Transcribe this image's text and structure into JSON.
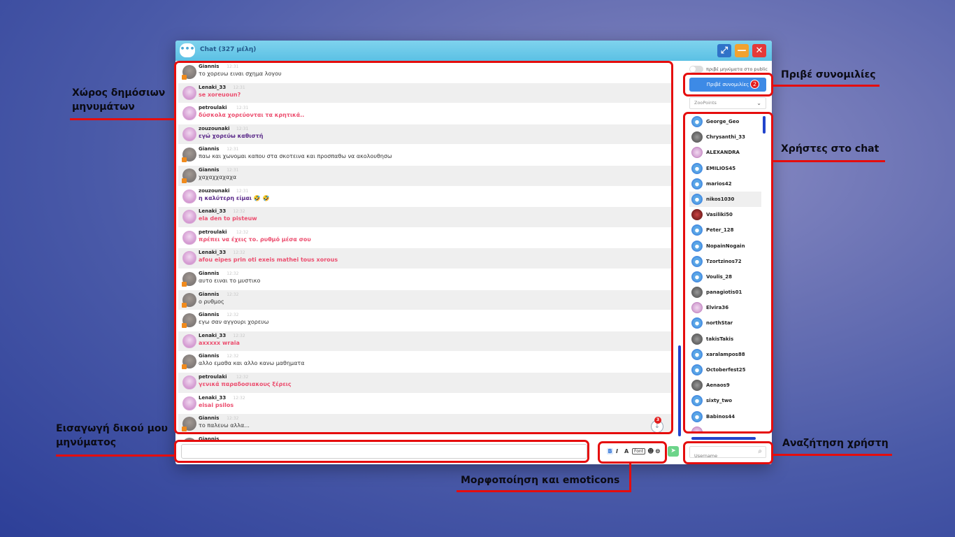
{
  "window": {
    "title": "Chat (327 μέλη)"
  },
  "messages": [
    {
      "nick": "Giannis",
      "time": "12:31",
      "text": "το χορευω ειναι σχημα λογου",
      "style": "normal",
      "gender": "m"
    },
    {
      "nick": "Lenaki_33",
      "time": "12:31",
      "text": "se xoreuoun?",
      "style": "pink",
      "gender": "f"
    },
    {
      "nick": "petroulaki",
      "time": "12:31",
      "text": "δύσκολα χορεύονται τα κρητικά..",
      "style": "pink",
      "gender": "f"
    },
    {
      "nick": "zouzounaki",
      "time": "12:31",
      "text": "εγώ χορεύω καθιστή",
      "style": "purple",
      "gender": "f"
    },
    {
      "nick": "Giannis",
      "time": "12:31",
      "text": "παω και χωνομαι καπου στα σκοτεινα και προσπαθω να ακολουθησω",
      "style": "normal",
      "gender": "m"
    },
    {
      "nick": "Giannis",
      "time": "12:31",
      "text": "χαχαχχαχαχα",
      "style": "normal",
      "gender": "m"
    },
    {
      "nick": "zouzounaki",
      "time": "12:31",
      "text": "η καλύτερη είμαι 🤣 🤣",
      "style": "purple",
      "gender": "f"
    },
    {
      "nick": "Lenaki_33",
      "time": "12:32",
      "text": "ela den to pisteuw",
      "style": "pink",
      "gender": "f"
    },
    {
      "nick": "petroulaki",
      "time": "12:32",
      "text": "πρέπει να έχεις το. ρυθμό μέσα σου",
      "style": "pink",
      "gender": "f"
    },
    {
      "nick": "Lenaki_33",
      "time": "12:32",
      "text": "afou eipes prin oti exeis mathei tous xorous",
      "style": "pink",
      "gender": "f"
    },
    {
      "nick": "Giannis",
      "time": "12:32",
      "text": "αυτο ειναι το μυστικο",
      "style": "normal",
      "gender": "m"
    },
    {
      "nick": "Giannis",
      "time": "12:32",
      "text": "ο ρυθμος",
      "style": "normal",
      "gender": "m"
    },
    {
      "nick": "Giannis",
      "time": "12:32",
      "text": "εγω σαν αγγουρι χορευω",
      "style": "normal",
      "gender": "m"
    },
    {
      "nick": "Lenaki_33",
      "time": "12:32",
      "text": "axxxxx wraia",
      "style": "pink",
      "gender": "f"
    },
    {
      "nick": "Giannis",
      "time": "12:32",
      "text": "αλλο εμαθα και αλλο κανω μαθηματα",
      "style": "normal",
      "gender": "m"
    },
    {
      "nick": "petroulaki",
      "time": "12:32",
      "text": "γενικά παραδοσιακους ξέρεις",
      "style": "pink",
      "gender": "f"
    },
    {
      "nick": "Lenaki_33",
      "time": "12:32",
      "text": "eisai psilos",
      "style": "pink",
      "gender": "f"
    },
    {
      "nick": "Giannis",
      "time": "12:32",
      "text": "το παλευω αλλα...",
      "style": "normal",
      "gender": "m"
    },
    {
      "nick": "Giannis",
      "time": "",
      "text": "",
      "style": "normal",
      "gender": "m"
    }
  ],
  "new_messages_count": "3",
  "composer": {
    "placeholder": ""
  },
  "formatting": {
    "bold": "B",
    "italic": "I",
    "color": "A",
    "font": "Font",
    "emoji": "☻",
    "gif": "⊜"
  },
  "sidebar": {
    "public_toggle_label": "πριβέ μηνύματα στο public",
    "private_button_label": "Πριβέ συνομιλίες",
    "private_count": "2",
    "points_select": "ZooPoints",
    "users": [
      {
        "name": "George_Geo",
        "avatar": "def"
      },
      {
        "name": "Chrysanthi_33",
        "avatar": "photo"
      },
      {
        "name": "ALEXANDRA",
        "avatar": "f"
      },
      {
        "name": "EMILIOS45",
        "avatar": "def"
      },
      {
        "name": "marios42",
        "avatar": "def"
      },
      {
        "name": "nikos1030",
        "avatar": "def"
      },
      {
        "name": "Vasiliki50",
        "avatar": "red"
      },
      {
        "name": "Peter_128",
        "avatar": "def"
      },
      {
        "name": "NopainNogain",
        "avatar": "def"
      },
      {
        "name": "Tzortzinos72",
        "avatar": "def"
      },
      {
        "name": "Voulis_28",
        "avatar": "def"
      },
      {
        "name": "panagiotis01",
        "avatar": "photo"
      },
      {
        "name": "Elvira36",
        "avatar": "f"
      },
      {
        "name": "northStar",
        "avatar": "def"
      },
      {
        "name": "takisTakis",
        "avatar": "photo"
      },
      {
        "name": "xaralampos88",
        "avatar": "def"
      },
      {
        "name": "Octoberfest25",
        "avatar": "def"
      },
      {
        "name": "Aenaos9",
        "avatar": "photo"
      },
      {
        "name": "sixty_two",
        "avatar": "def"
      },
      {
        "name": "Babinos44",
        "avatar": "def"
      },
      {
        "name": "",
        "avatar": "f"
      }
    ],
    "search_placeholder": "Username"
  },
  "annotations": {
    "public_area": "Χώρος δημόσιων\nμηνυμάτων",
    "private_chats": "Πριβέ συνομιλίες",
    "users_in_chat": "Χρήστες στο chat",
    "own_message_input": "Εισαγωγή δικού μου\nμηνύματος",
    "formatting_emoticons": "Μορφοποίηση και emoticons",
    "user_search": "Αναζήτηση χρήστη"
  },
  "colors": {
    "highlight": "#e50d0d",
    "titlebar": "#5bc0e4",
    "accent": "#3d8ae6"
  }
}
